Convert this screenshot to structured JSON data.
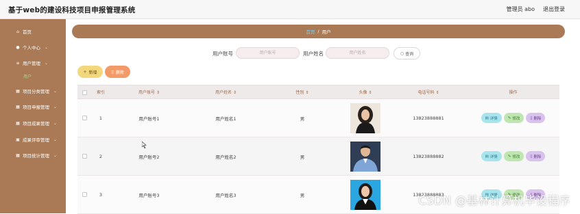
{
  "app": {
    "title": "基于web的建设科技项目申报管理系统"
  },
  "topbar": {
    "user_label": "管理员 abo",
    "logout_label": "退出登录"
  },
  "sidebar": {
    "items": [
      {
        "label": "首页",
        "icon": "home-icon",
        "chevron": false
      },
      {
        "label": "个人中心",
        "icon": "person-icon",
        "chevron": true
      },
      {
        "label": "用户管理",
        "icon": "list-icon",
        "chevron": true
      },
      {
        "label": "项目分类管理",
        "icon": "grid-icon",
        "chevron": true
      },
      {
        "label": "项目申报管理",
        "icon": "grid-icon",
        "chevron": true
      },
      {
        "label": "项目成果管理",
        "icon": "grid-icon",
        "chevron": true
      },
      {
        "label": "成果评审管理",
        "icon": "picture-icon",
        "chevron": true
      },
      {
        "label": "项目统计管理",
        "icon": "grid-icon",
        "chevron": true
      }
    ],
    "active_sub": "用户"
  },
  "breadcrumb": {
    "home": "首页",
    "sep": "/",
    "current": "用户"
  },
  "search": {
    "account_label": "用户账号",
    "account_placeholder": "用户账号",
    "name_label": "用户姓名",
    "name_placeholder": "用户姓名",
    "button_label": "查询"
  },
  "actions": {
    "add_label": "新增",
    "delete_label": "删除"
  },
  "table": {
    "headers": [
      "索引",
      "用户账号",
      "用户姓名",
      "性别",
      "头像",
      "电话号码",
      "操作"
    ],
    "rows": [
      {
        "index": "1",
        "account": "用户账号1",
        "name": "用户姓名1",
        "gender": "男",
        "phone": "13823888881"
      },
      {
        "index": "2",
        "account": "用户账号2",
        "name": "用户姓名2",
        "gender": "男",
        "phone": "13823888882"
      },
      {
        "index": "3",
        "account": "用户账号3",
        "name": "用户姓名3",
        "gender": "男",
        "phone": "13823888883"
      }
    ],
    "op_labels": {
      "detail": "详情",
      "edit": "修改",
      "delete": "删除"
    }
  },
  "watermark": "CSDN @基林计算机毕设程序",
  "colors": {
    "sidebar": "#a97a55",
    "breadcrumb": "#a97a55",
    "add": "#f2d77d",
    "delete": "#f29a68"
  }
}
